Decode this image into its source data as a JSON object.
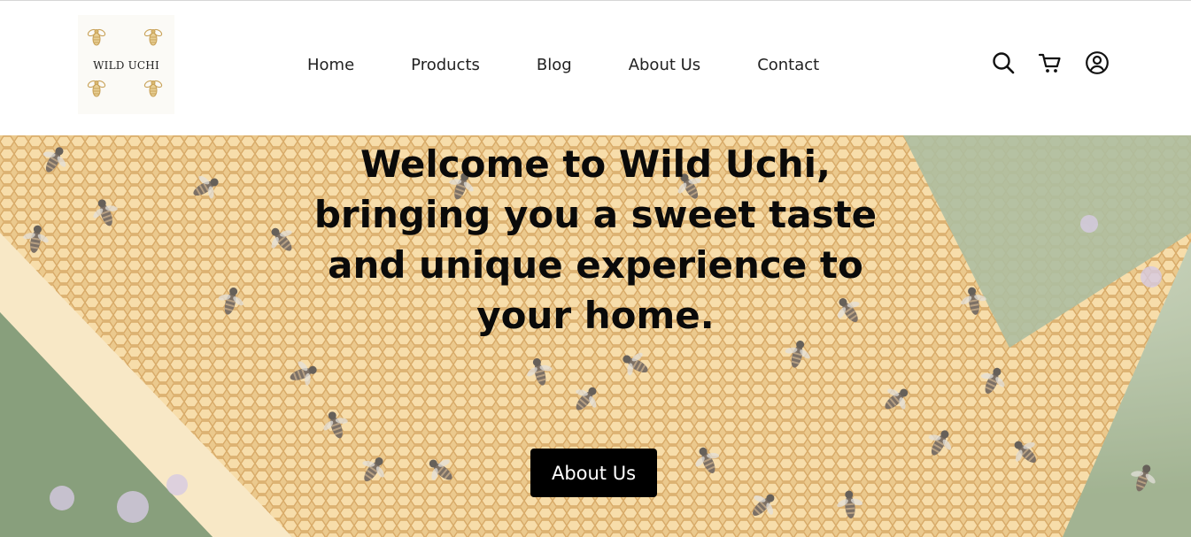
{
  "brand": {
    "logo_text": "WILD UCHI",
    "logo_icon": "bee-icon"
  },
  "nav": {
    "items": [
      {
        "label": "Home"
      },
      {
        "label": "Products"
      },
      {
        "label": "Blog"
      },
      {
        "label": "About Us"
      },
      {
        "label": "Contact"
      }
    ]
  },
  "header_icons": [
    "search-icon",
    "cart-icon",
    "account-icon"
  ],
  "hero": {
    "title": "Welcome to Wild Uchi,\nbringing you a sweet taste\nand unique experience to\nyour home.",
    "button_label": "About Us",
    "background": "honeycomb-with-bees-photo"
  },
  "colors": {
    "text": "#222222",
    "button_bg": "#000000",
    "button_text": "#ffffff",
    "honey": "#d9a24a",
    "foliage": "#7f9a6a"
  }
}
